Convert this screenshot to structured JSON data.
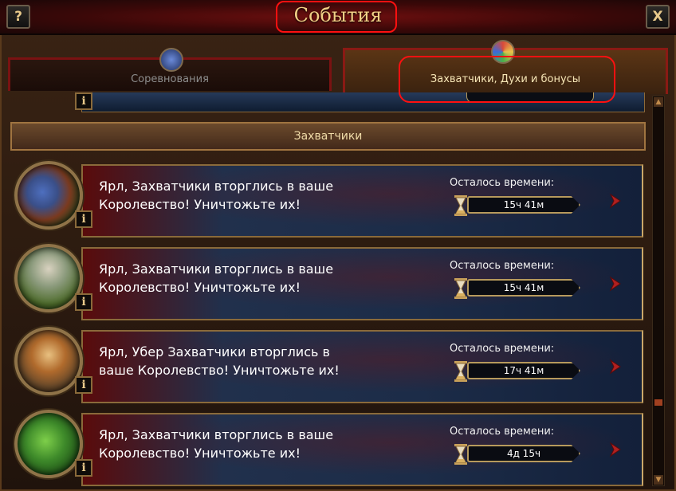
{
  "window": {
    "title": "События",
    "help_label": "?",
    "close_label": "X"
  },
  "tabs": [
    {
      "label": "Соревнования",
      "active": false,
      "icon": "blue-medal-icon"
    },
    {
      "label": "Захватчики, Духи и бонусы",
      "active": true,
      "icon": "color-medal-icon"
    }
  ],
  "section": {
    "title": "Захватчики"
  },
  "info_label": "i",
  "events": [
    {
      "message": "Ярл, Захватчики вторглись в ваше Королевство! Уничтожьте их!",
      "remaining_label": "Осталось времени:",
      "timer": "15ч 41м",
      "portrait": "knight-portrait"
    },
    {
      "message": "Ярл, Захватчики вторглись в ваше Королевство! Уничтожьте их!",
      "remaining_label": "Осталось времени:",
      "timer": "15ч 41м",
      "portrait": "vulture-portrait"
    },
    {
      "message": "Ярл, Убер Захватчики вторглись в ваше Королевство! Уничтожьте их!",
      "remaining_label": "Осталось времени:",
      "timer": "17ч 41м",
      "portrait": "viking-warrior-portrait"
    },
    {
      "message": "Ярл, Захватчики вторглись в ваше Королевство! Уничтожьте их!",
      "remaining_label": "Осталось времени:",
      "timer": "4д 15ч",
      "portrait": "snake-portrait"
    }
  ],
  "colors": {
    "accent_gold": "#f1cf85",
    "highlight_red": "#ff1010",
    "card_blue": "#1c2c48"
  }
}
